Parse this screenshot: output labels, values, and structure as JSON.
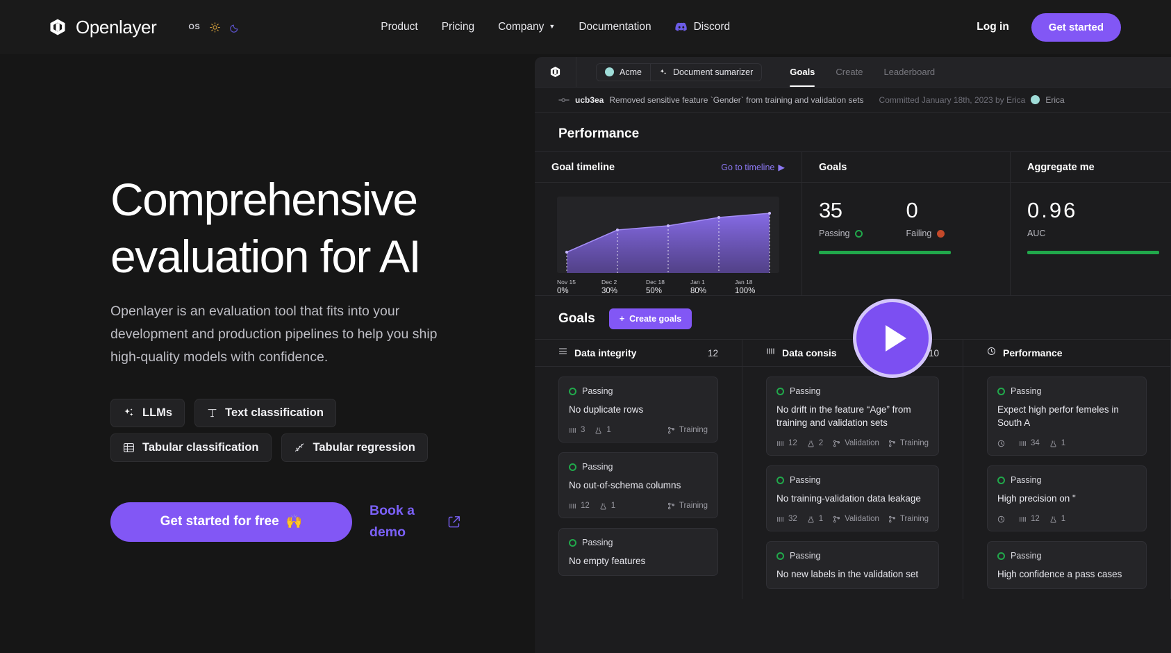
{
  "nav": {
    "brand": "Openlayer",
    "theme": {
      "os_label": "OS",
      "sun": "sun-icon",
      "moon": "moon-icon"
    },
    "links": [
      {
        "label": "Product",
        "caret": false
      },
      {
        "label": "Pricing",
        "caret": false
      },
      {
        "label": "Company",
        "caret": true
      },
      {
        "label": "Documentation",
        "caret": false
      }
    ],
    "discord": "Discord",
    "login": "Log in",
    "cta": "Get started"
  },
  "hero": {
    "title": "Comprehensive evaluation for AI",
    "subtitle": "Openlayer is an evaluation tool that fits into your development and production pipelines to help you ship high-quality models with confidence.",
    "pills_row1": [
      {
        "label": "LLMs",
        "icon": "sparkle-icon"
      },
      {
        "label": "Text classification",
        "icon": "text-icon"
      }
    ],
    "pills_row2": [
      {
        "label": "Tabular classification",
        "icon": "table-icon"
      },
      {
        "label": "Tabular regression",
        "icon": "scatter-icon"
      }
    ],
    "cta_primary": "Get started for free",
    "cta_primary_emoji": "🙌",
    "cta_secondary": "Book a demo",
    "external_icon": "external-link-icon"
  },
  "app": {
    "topbar": {
      "logo": "openlayer-mark-icon",
      "workspace": "Acme",
      "project": "Document sumarizer",
      "project_icon": "sparkle-icon",
      "tabs": [
        {
          "label": "Goals",
          "active": true
        },
        {
          "label": "Create",
          "active": false
        },
        {
          "label": "Leaderboard",
          "active": false
        }
      ]
    },
    "commit": {
      "hash": "ucb3ea",
      "message": "Removed sensitive feature `Gender` from training and validation sets",
      "meta": "Committed January 18th, 2023 by Erica",
      "author": "Erica"
    },
    "performance_title": "Performance",
    "timeline": {
      "title": "Goal timeline",
      "link": "Go to timeline"
    },
    "goals_panel": {
      "title": "Goals",
      "passing_value": "35",
      "passing_label": "Passing",
      "failing_value": "0",
      "failing_label": "Failing"
    },
    "aggregate_panel": {
      "title": "Aggregate me",
      "value": "0.96",
      "label": "AUC"
    },
    "goals_section": {
      "title": "Goals",
      "create_label": "Create goals",
      "create_icon": "plus-icon"
    },
    "columns": [
      {
        "name": "Data integrity",
        "count": "12",
        "icon": "list-icon",
        "cards": [
          {
            "status": "Passing",
            "title": "No duplicate rows",
            "metrics": [
              {
                "icon": "bars-icon",
                "value": "3"
              },
              {
                "icon": "flask-icon",
                "value": "1"
              }
            ],
            "tags": [
              {
                "icon": "branch-icon",
                "label": "Training"
              }
            ]
          },
          {
            "status": "Passing",
            "title": "No out-of-schema columns",
            "metrics": [
              {
                "icon": "bars-icon",
                "value": "12"
              },
              {
                "icon": "flask-icon",
                "value": "1"
              }
            ],
            "tags": [
              {
                "icon": "branch-icon",
                "label": "Training"
              }
            ]
          },
          {
            "status": "Passing",
            "title": "No empty features",
            "metrics": [],
            "tags": []
          }
        ]
      },
      {
        "name": "Data consis",
        "count": "10",
        "icon": "bars-icon",
        "cards": [
          {
            "status": "Passing",
            "title": "No drift in the feature “Age” from training and validation sets",
            "metrics": [
              {
                "icon": "bars-icon",
                "value": "12"
              },
              {
                "icon": "flask-icon",
                "value": "2"
              }
            ],
            "tags": [
              {
                "icon": "branch-icon",
                "label": "Validation"
              },
              {
                "icon": "branch-icon",
                "label": "Training"
              }
            ]
          },
          {
            "status": "Passing",
            "title": "No training-validation data leakage",
            "metrics": [
              {
                "icon": "bars-icon",
                "value": "32"
              },
              {
                "icon": "flask-icon",
                "value": "1"
              }
            ],
            "tags": [
              {
                "icon": "branch-icon",
                "label": "Validation"
              },
              {
                "icon": "branch-icon",
                "label": "Training"
              }
            ]
          },
          {
            "status": "Passing",
            "title": "No new labels in the validation set",
            "metrics": [],
            "tags": []
          }
        ]
      },
      {
        "name": "Performance",
        "count": "",
        "icon": "clock-icon",
        "cards": [
          {
            "status": "Passing",
            "title": "Expect high perfor femeles in South A",
            "metrics": [
              {
                "icon": "clock-icon",
                "value": ""
              },
              {
                "icon": "bars-icon",
                "value": "34"
              },
              {
                "icon": "flask-icon",
                "value": "1"
              }
            ],
            "tags": []
          },
          {
            "status": "Passing",
            "title": "High precision on \"",
            "metrics": [
              {
                "icon": "clock-icon",
                "value": ""
              },
              {
                "icon": "bars-icon",
                "value": "12"
              },
              {
                "icon": "flask-icon",
                "value": "1"
              }
            ],
            "tags": []
          },
          {
            "status": "Passing",
            "title": "High confidence a pass cases",
            "metrics": [],
            "tags": []
          }
        ]
      }
    ],
    "play_button": "play-button"
  },
  "chart_data": {
    "type": "area",
    "title": "Goal timeline",
    "x": [
      "Nov 15",
      "Dec 2",
      "Dec 18",
      "Jan 1",
      "Jan 18"
    ],
    "tick_labels": [
      "0%",
      "30%",
      "50%",
      "80%",
      "100%"
    ],
    "values": [
      30,
      62,
      68,
      80,
      86
    ],
    "xlabel": "",
    "ylabel": "",
    "ylim": [
      0,
      100
    ],
    "grid": false,
    "legend": "none",
    "line_color": "#8b6ff0",
    "fill_color": "#6a51b8"
  },
  "colors": {
    "accent": "#8257f5",
    "accent_text": "#7b61f8",
    "pass_green": "#21a84b",
    "fail_red": "#c4492a",
    "teal": "#9fdcd8",
    "bg": "#161616",
    "app_bg": "#1c1c1e"
  }
}
